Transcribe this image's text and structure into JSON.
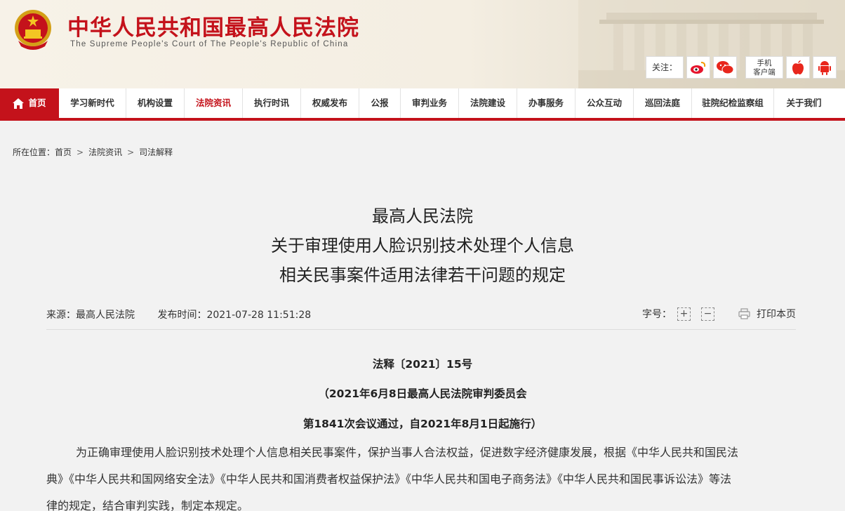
{
  "header": {
    "site_title": "中华人民共和国最高人民法院",
    "site_subtitle": "The Supreme People's Court of The People's Republic of China",
    "follow_label": "关注：",
    "mobile_client_line1": "手机",
    "mobile_client_line2": "客户端"
  },
  "nav": {
    "items": [
      {
        "label": "首页"
      },
      {
        "label": "学习新时代"
      },
      {
        "label": "机构设置"
      },
      {
        "label": "法院资讯"
      },
      {
        "label": "执行时讯"
      },
      {
        "label": "权威发布"
      },
      {
        "label": "公报"
      },
      {
        "label": "审判业务"
      },
      {
        "label": "法院建设"
      },
      {
        "label": "办事服务"
      },
      {
        "label": "公众互动"
      },
      {
        "label": "巡回法庭"
      },
      {
        "label": "驻院纪检监察组"
      },
      {
        "label": "关于我们"
      }
    ]
  },
  "breadcrumb": {
    "prefix": "所在位置：",
    "items": [
      "首页",
      "法院资讯",
      "司法解释"
    ]
  },
  "article": {
    "title_lines": [
      "最高人民法院",
      "关于审理使用人脸识别技术处理个人信息",
      "相关民事案件适用法律若干问题的规定"
    ],
    "source": "来源：最高人民法院",
    "publish_time": "发布时间：2021-07-28 11:51:28",
    "font_size_label": "字号：",
    "zoom_in": "+",
    "zoom_out": "−",
    "print_label": "打印本页",
    "doc_number": "法释〔2021〕15号",
    "adoption_line1": "（2021年6月8日最高人民法院审判委员会",
    "adoption_line2": "第1841次会议通过，自2021年8月1日起施行）",
    "body_lines": [
      "为正确审理使用人脸识别技术处理个人信息相关民事案件，保护当事人合法权益，促进数字经济健康发展，根据《中华人民共和国民法",
      "典》《中华人民共和国网络安全法》《中华人民共和国消费者权益保护法》《中华人民共和国电子商务法》《中华人民共和国民事诉讼法》等法",
      "律的规定，结合审判实践，制定本规定。"
    ]
  },
  "colors": {
    "brand_red": "#c4121b",
    "page_bg": "#f2f2f2"
  },
  "icons": [
    "emblem-icon",
    "weibo-icon",
    "wechat-icon",
    "apple-icon",
    "android-icon",
    "home-icon",
    "print-icon"
  ]
}
